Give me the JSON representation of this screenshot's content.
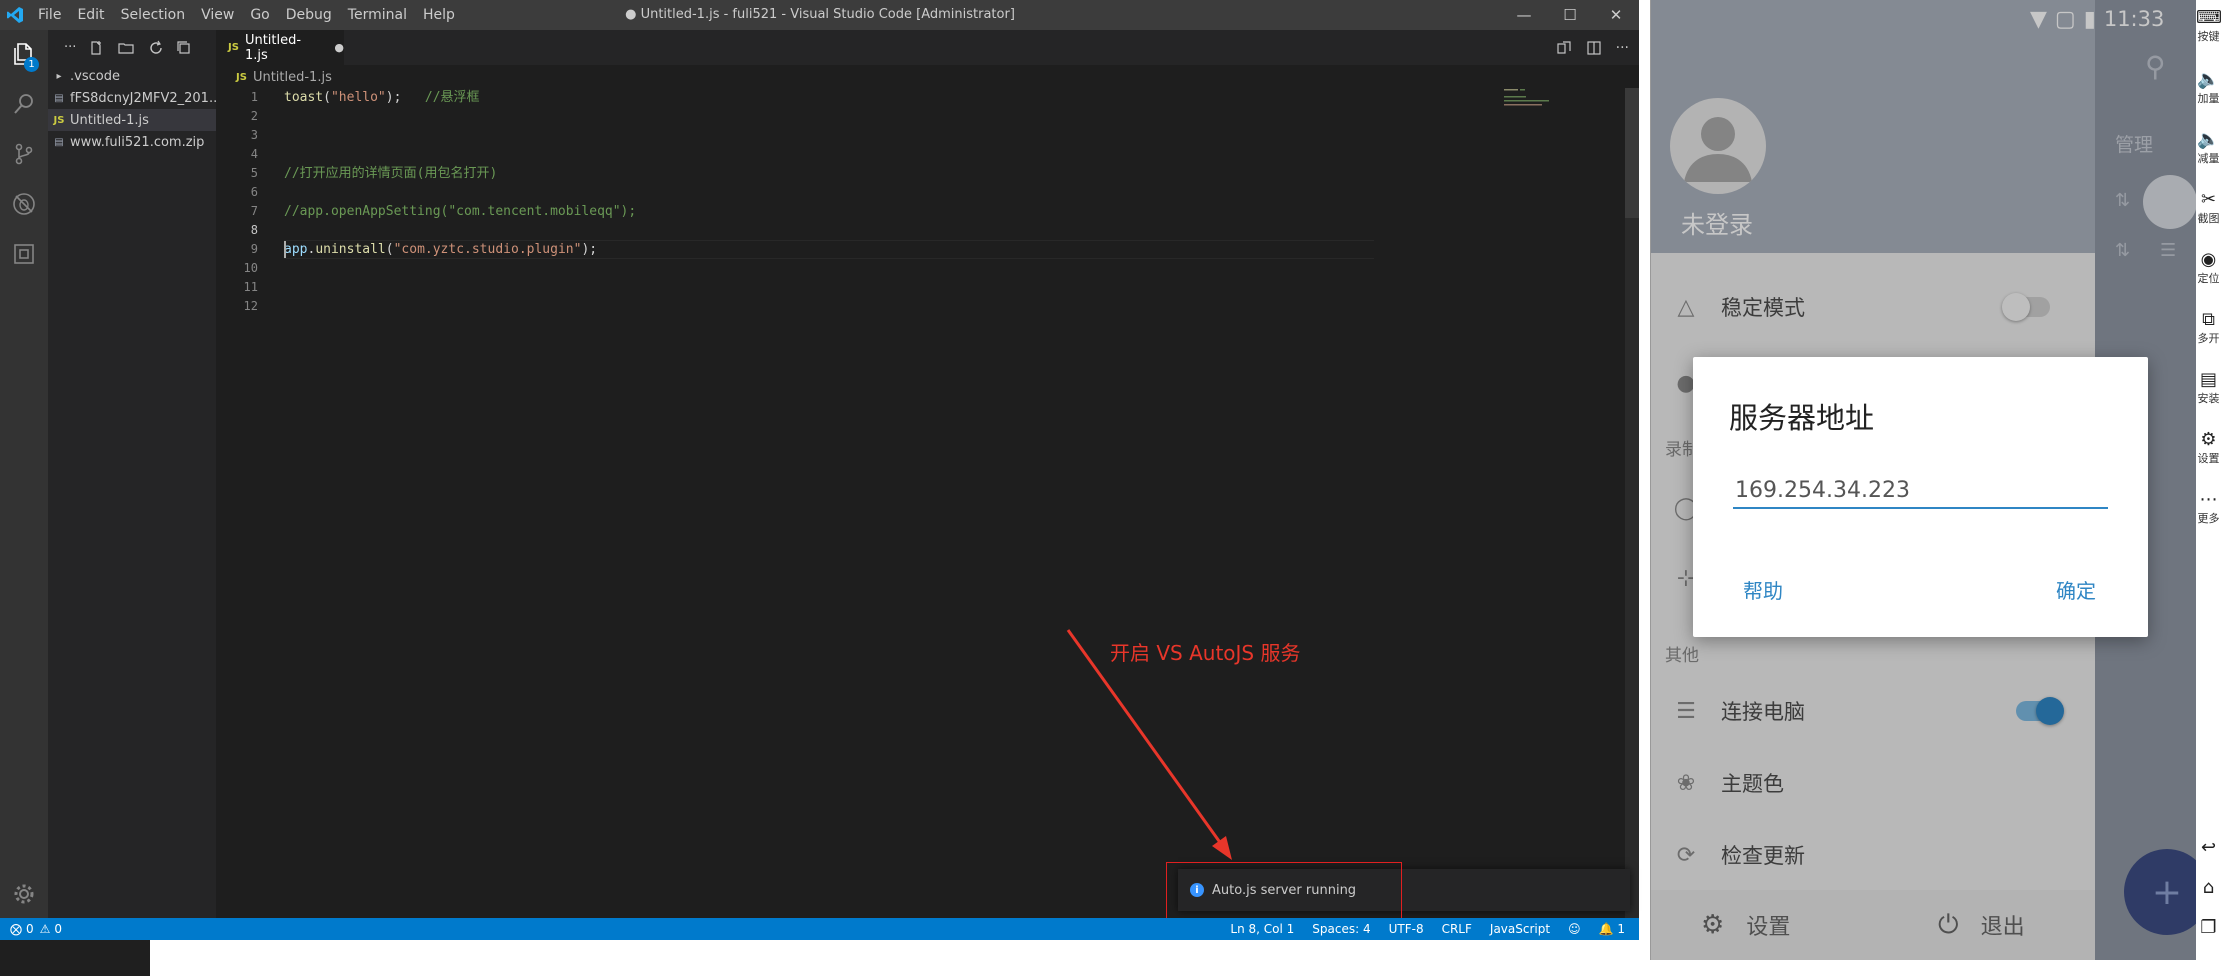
{
  "vscode": {
    "menu": [
      "File",
      "Edit",
      "Selection",
      "View",
      "Go",
      "Debug",
      "Terminal",
      "Help"
    ],
    "window_title": "● Untitled-1.js - fuli521 - Visual Studio Code [Administrator]",
    "explorer_more": "...",
    "activity_badge": "1",
    "explorer_items": [
      ".vscode",
      "fFS8dcnyJ2MFV2_201...",
      "Untitled-1.js",
      "www.fuli521.com.zip"
    ],
    "tab_label": "Untitled-1.js",
    "tab_dirty": "●",
    "js_badge": "JS",
    "breadcrumb": "Untitled-1.js",
    "line_numbers": [
      "1",
      "2",
      "3",
      "4",
      "5",
      "6",
      "7",
      "8",
      "9",
      "10",
      "11",
      "12"
    ],
    "code": {
      "l1_fn": "toast",
      "l1_open": "(",
      "l1_str": "\"hello\"",
      "l1_close": ");   ",
      "l1_cm": "//悬浮框",
      "l5_cm": "//打开应用的详情页面(用包名打开)",
      "l7_cm": "//app.openAppSetting(\"com.tencent.mobileqq\");",
      "l9_id": "app",
      "l9_dot": ".",
      "l9_fn": "uninstall",
      "l9_open": "(",
      "l9_str": "\"com.yztc.studio.plugin\"",
      "l9_close": ");"
    },
    "toast_text": "Auto.js server running",
    "status": {
      "errors": "0",
      "warnings": "0",
      "ln_col": "Ln 8, Col 1",
      "spaces": "Spaces: 4",
      "encoding": "UTF-8",
      "eol": "CRLF",
      "language": "JavaScript",
      "bell_count": "1"
    }
  },
  "annotation": "开启 VS  AutoJS 服务",
  "phone": {
    "clock": "11:33",
    "login": "未登录",
    "manage": "管理",
    "stable_mode": "稳定模式",
    "section_record": "录制",
    "section_other": "其他",
    "connect_pc": "连接电脑",
    "theme_color": "主题色",
    "check_update": "检查更新",
    "settings": "设置",
    "exit": "退出",
    "fab": "+",
    "dialog": {
      "title": "服务器地址",
      "input_value": "169.254.34.223",
      "help": "帮助",
      "ok": "确定"
    },
    "sidebar": [
      "按键",
      "加量",
      "减量",
      "截图",
      "定位",
      "多开",
      "安装",
      "设置",
      "更多"
    ]
  },
  "colors": {
    "vscode_accent": "#007acc",
    "annotation_red": "#e8362a",
    "phone_accent": "#2f86c4"
  }
}
